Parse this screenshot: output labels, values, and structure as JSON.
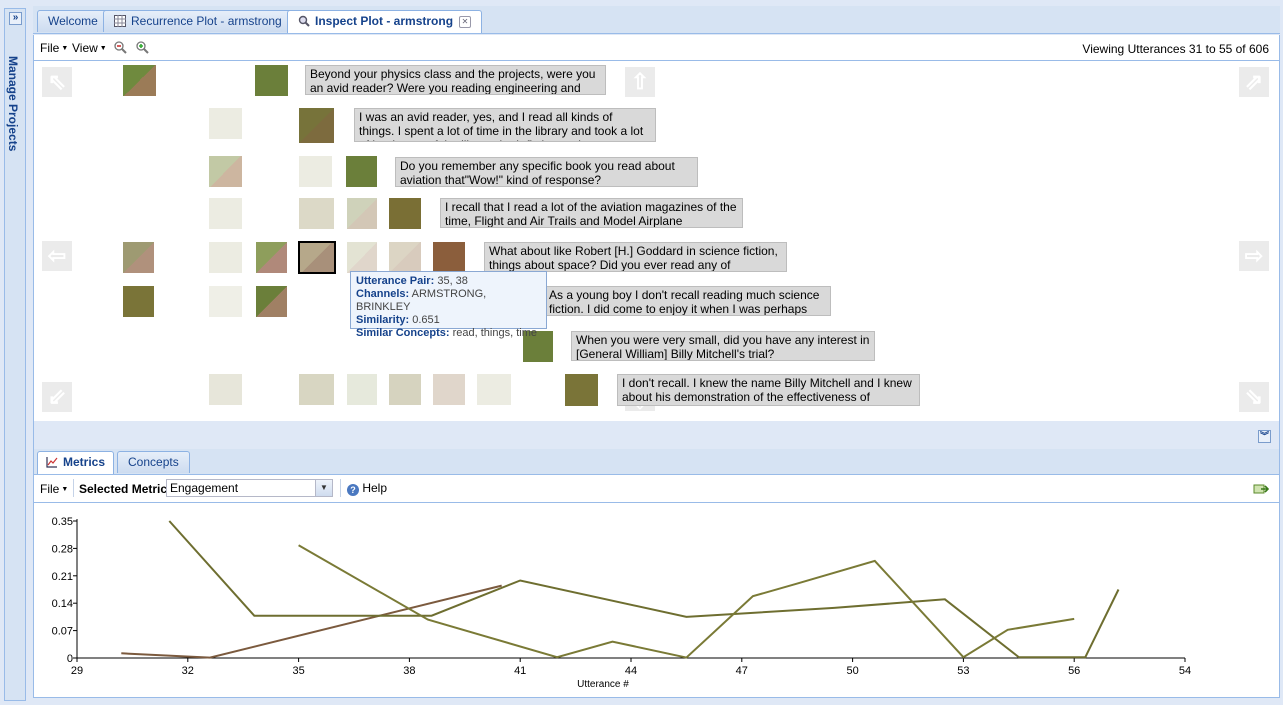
{
  "left_panel": {
    "title": "Manage Projects"
  },
  "top_tabs": [
    {
      "label": "Welcome"
    },
    {
      "label": "Recurrence Plot - armstrong"
    },
    {
      "label": "Inspect Plot - armstrong"
    }
  ],
  "toolbar": {
    "file_label": "File",
    "view_label": "View",
    "status": "Viewing Utterances 31 to 55 of 606"
  },
  "utterances": [
    "Beyond your physics class and the projects, were you an avid reader? Were you reading engineering and",
    "I was an avid reader, yes, and I read all kinds of things. I spent a lot of time in the library and took a lot of books out of the library, both fiction and",
    "Do you remember any specific book you read about aviation that\"Wow!\" kind of response?",
    "I recall that I read a lot of the aviation magazines of the time, Flight and Air Trails and Model Airplane",
    "What about like Robert [H.] Goddard in science fiction, things about space? Did you ever read any of",
    "As a young boy I don't recall reading much science fiction. I did come to enjoy it when I was perhaps late",
    "When you were very small, did you have any interest in [General William] Billy Mitchell's trial?",
    "I don't recall. I knew the name Billy Mitchell and I knew about his demonstration of the effectiveness of"
  ],
  "cell_colors": {
    "olive": "#6b7f3a",
    "brown": "#8b5e3c",
    "dark_olive": "#7a6f35",
    "pale": "#ecece2",
    "light": "#d8d6c2"
  },
  "tooltip": {
    "pair_label": "Utterance Pair:",
    "pair_value": "35, 38",
    "channels_label": "Channels:",
    "channels_value": "ARMSTRONG, BRINKLEY",
    "similarity_label": "Similarity:",
    "similarity_value": "0.651",
    "concepts_label": "Similar Concepts:",
    "concepts_value": "read, things, time"
  },
  "bottom_tabs": [
    {
      "label": "Metrics"
    },
    {
      "label": "Concepts"
    }
  ],
  "metrics_toolbar": {
    "file_label": "File",
    "selected_metric_label": "Selected Metric:",
    "selected_metric_value": "Engagement",
    "help_label": "Help"
  },
  "chart_data": {
    "type": "line",
    "xlabel": "Utterance #",
    "ylabel": "",
    "xlim": [
      29,
      54
    ],
    "ylim": [
      0,
      0.35
    ],
    "x_ticks": [
      "29",
      "32",
      "35",
      "38",
      "41",
      "44",
      "47",
      "50",
      "53",
      "56",
      "54"
    ],
    "y_ticks": [
      "0",
      "0.07",
      "0.14",
      "0.21",
      "0.28",
      "0.35"
    ],
    "series": [
      {
        "color": "#7b5a3e",
        "points": [
          [
            30.2,
            0.012
          ],
          [
            32.6,
            0.001
          ],
          [
            40.5,
            0.185
          ]
        ]
      },
      {
        "color": "#6e6e30",
        "points": [
          [
            31.5,
            0.35
          ],
          [
            33.8,
            0.108
          ],
          [
            38.6,
            0.108
          ],
          [
            41,
            0.198
          ],
          [
            45.5,
            0.105
          ],
          [
            49.5,
            0.128
          ],
          [
            52.5,
            0.15
          ],
          [
            54.5,
            0.002
          ],
          [
            56.3,
            0.002
          ],
          [
            57.2,
            0.175
          ]
        ]
      },
      {
        "color": "#7a7a36",
        "points": [
          [
            35,
            0.288
          ],
          [
            38.5,
            0.098
          ],
          [
            42,
            0.002
          ],
          [
            43.5,
            0.042
          ],
          [
            45.5,
            0.001
          ],
          [
            47.3,
            0.158
          ],
          [
            48.5,
            0.19
          ],
          [
            50.6,
            0.248
          ],
          [
            53,
            0.002
          ],
          [
            54.2,
            0.072
          ],
          [
            56,
            0.1
          ]
        ]
      }
    ]
  }
}
